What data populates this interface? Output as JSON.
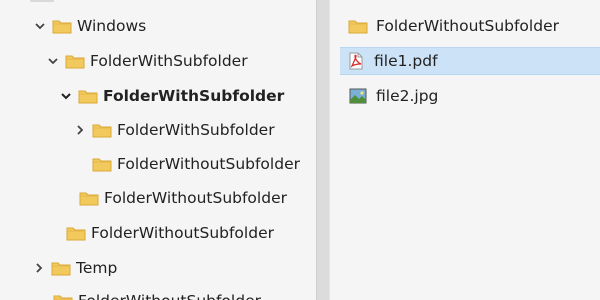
{
  "tree": {
    "items": [
      {
        "label": "Windows",
        "toggle": "expanded",
        "bold": false
      },
      {
        "label": "FolderWithSubfolder",
        "toggle": "expanded",
        "bold": false
      },
      {
        "label": "FolderWithSubfolder",
        "toggle": "expanded",
        "bold": true
      },
      {
        "label": "FolderWithSubfolder",
        "toggle": "collapsed",
        "bold": false
      },
      {
        "label": "FolderWithoutSubfolder",
        "toggle": "none",
        "bold": false
      },
      {
        "label": "FolderWithoutSubfolder",
        "toggle": "none",
        "bold": false
      },
      {
        "label": "FolderWithoutSubfolder",
        "toggle": "none",
        "bold": false
      },
      {
        "label": "Temp",
        "toggle": "collapsed",
        "bold": false
      },
      {
        "label": "FolderWithoutSubfolder",
        "toggle": "none",
        "bold": false
      }
    ]
  },
  "files": {
    "items": [
      {
        "label": "FolderWithoutSubfolder",
        "icon": "folder-icon",
        "selected": false
      },
      {
        "label": "file1.pdf",
        "icon": "pdf-file-icon",
        "selected": true
      },
      {
        "label": "file2.jpg",
        "icon": "image-file-icon",
        "selected": false
      }
    ]
  },
  "colors": {
    "folder": "#f2c95c",
    "selection": "#cce3f7",
    "pane_bg": "#f5f5f5",
    "splitter": "#dcdcdc"
  }
}
